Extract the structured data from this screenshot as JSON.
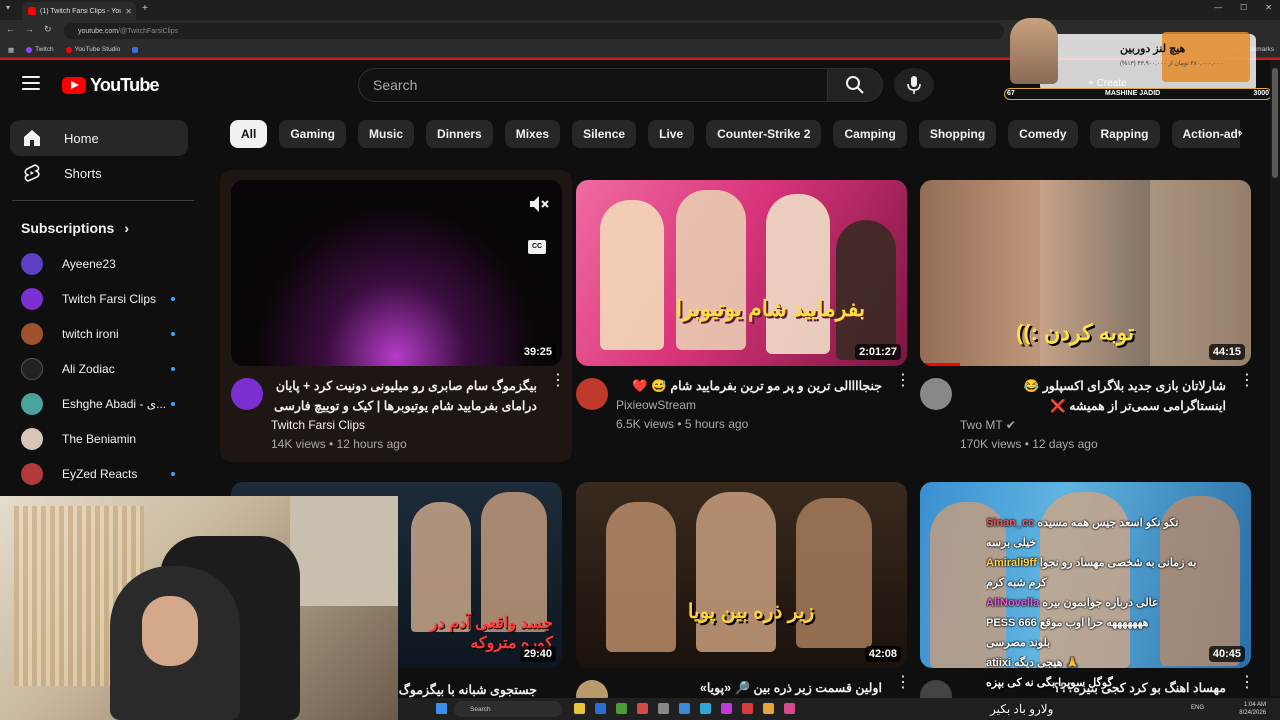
{
  "browser": {
    "tab_title": "(1) Twitch Farsi Clips - YouTube",
    "new_tab": "+",
    "url_host": "youtube.com",
    "url_path": "/@TwitchFarsiClips",
    "bookmarks": [
      {
        "label": "Twitch",
        "color": "#9146ff"
      },
      {
        "label": "YouTube Studio",
        "color": "#ff0000"
      }
    ],
    "all_bookmarks": "All Bookmarks"
  },
  "header": {
    "logo_text": "YouTube",
    "search_placeholder": "Search",
    "create_label": "+ Create"
  },
  "overlay": {
    "title": "هیچ لنز دوربین",
    "subtitle": "۳۸۰,۰۰۰,۰۰۰ تومان از ۴۳,۹۰۰,۰۰۰ (۱۳%)",
    "bar_min": "67",
    "bar_label": "MASHINE JADID",
    "bar_max": "3000"
  },
  "sidebar": {
    "items": [
      {
        "label": "Home",
        "icon": "home-icon"
      },
      {
        "label": "Shorts",
        "icon": "shorts-icon"
      }
    ],
    "subscriptions_title": "Subscriptions",
    "subscriptions": [
      {
        "name": "Ayeene23",
        "color": "#5b3fc4",
        "dot": false
      },
      {
        "name": "Twitch Farsi Clips",
        "color": "#7b2fd1",
        "dot": true
      },
      {
        "name": "twitch ironi",
        "color": "#a0522d",
        "dot": true
      },
      {
        "name": "Ali Zodiac",
        "color": "#222222",
        "dot": true
      },
      {
        "name": "Eshghe Abadi - ی...",
        "color": "#4aa39a",
        "dot": true
      },
      {
        "name": "The Beniamin",
        "color": "#d9c6b8",
        "dot": false
      },
      {
        "name": "EyZed Reacts",
        "color": "#b33a3a",
        "dot": true
      }
    ]
  },
  "chips": [
    "All",
    "Gaming",
    "Music",
    "Dinners",
    "Mixes",
    "Silence",
    "Live",
    "Counter-Strike 2",
    "Camping",
    "Shopping",
    "Comedy",
    "Rapping",
    "Action-adventure"
  ],
  "videos": [
    {
      "title": "بیگزموگ سام صابری رو میلیونی دونیت کرد + پایان درامای بفرمایید شام یوتیوبرها | کیک و توییچ فارسی 873",
      "channel": "Twitch Farsi Clips",
      "meta": "14K views • 12 hours ago",
      "duration": "39:25",
      "thumb_text": "",
      "avatar_color": "#7b2fd1"
    },
    {
      "title": "جنجاااالی ترین و پر مو ترین بفرمایید شام 😅 ❤️",
      "channel": "PixieowStream",
      "meta": "6.5K views • 5 hours ago",
      "duration": "2:01:27",
      "thumb_text": "بفرمایید شام یوتیوبرا",
      "avatar_color": "#c0392b"
    },
    {
      "title": "شارلاتان بازی جدید بلاگرای اکسپلور 😂 اینستاگرامی سمی‌تر از همیشه ❌",
      "channel": "Two MT ✔",
      "meta": "170K views • 12 days ago",
      "duration": "44:15",
      "thumb_text": "توبه کردن :))",
      "avatar_color": "#888888"
    },
    {
      "title": "جستجوی شبانه با بیگزموگ در...",
      "channel": "",
      "meta": "",
      "duration": "29:40",
      "thumb_text": "جسد واقعی آدم در کوره متروکه",
      "avatar_color": "#555555"
    },
    {
      "title": "اولین قسمت زیر ذره بین 🔎 «پویا»",
      "channel": "",
      "meta": "",
      "duration": "42:08",
      "thumb_text": "زیر ذره بین پویا",
      "avatar_color": "#b89a6a"
    },
    {
      "title": "مهساد اهنگ بو کرد کجی بنیزه؟؟؟",
      "channel": "",
      "meta": "",
      "duration": "40:45",
      "thumb_text": "",
      "avatar_color": "#444444"
    }
  ],
  "chat": [
    {
      "user": "Sinan_cc",
      "text": "نکو نکو اسعد جیس همه مسیده",
      "color": "#e85a5a"
    },
    {
      "user": "",
      "text": "خیلی برسه",
      "color": "#ffffff"
    },
    {
      "user": "Amirali9ff",
      "text": "به زمانی به شخصی مهساد رو نجوا",
      "color": "#ffd24a"
    },
    {
      "user": "",
      "text": "کرم شبه کرم",
      "color": "#ffffff"
    },
    {
      "user": "AliNovella",
      "text": "عالی درباره جوابمون بیره",
      "color": "#e35bd8"
    },
    {
      "user": "PESS 666",
      "text": "هههههههه حرا اوب موقع",
      "color": "#ffffff"
    },
    {
      "user": "",
      "text": "بلوند مصرسی",
      "color": "#ffffff"
    },
    {
      "user": "atiixi",
      "text": "هیجی دیگه 🙏",
      "color": "#ffffff"
    },
    {
      "user": "",
      "text": "گوگل سوپرا بگی نه کی بپزه",
      "color": "#ffffff"
    }
  ],
  "caption": "ولارو باد بکیر",
  "taskbar": {
    "search": "Search",
    "lang": "ENG",
    "time": "1:04 AM",
    "date": "8/24/2026"
  }
}
